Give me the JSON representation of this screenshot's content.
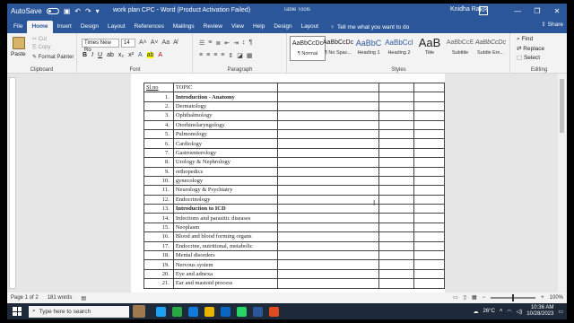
{
  "window": {
    "doc_title": "work plan CPC - Word (Product Activation Failed)",
    "context_title": "Table Tools",
    "user": "Knidha Raj",
    "user_badge": "KR",
    "autosave": "AutoSave",
    "controls": [
      "—",
      "❐",
      "✕"
    ]
  },
  "tabs": [
    "File",
    "Home",
    "Insert",
    "Design",
    "Layout",
    "References",
    "Mailings",
    "Review",
    "View",
    "Help",
    "Design",
    "Layout"
  ],
  "tell_me": "Tell me what you want to do",
  "share": "Share",
  "ribbon": {
    "clipboard": {
      "label": "Clipboard",
      "paste": "Paste",
      "cut": "Cut",
      "copy": "Copy",
      "format_painter": "Format Painter"
    },
    "font": {
      "label": "Font",
      "family": "Times New Ro",
      "size": "14"
    },
    "paragraph": {
      "label": "Paragraph"
    },
    "styles": {
      "label": "Styles",
      "items": [
        {
          "preview": "AaBbCcDc",
          "name": "¶ Normal"
        },
        {
          "preview": "AaBbCcDc",
          "name": "¶ No Spac..."
        },
        {
          "preview": "AaBbC",
          "name": "Heading 1"
        },
        {
          "preview": "AaBbCcI",
          "name": "Heading 2"
        },
        {
          "preview": "AaB",
          "name": "Title"
        },
        {
          "preview": "AaBbCcE",
          "name": "Subtitle"
        },
        {
          "preview": "AaBbCcDc",
          "name": "Subtle Em..."
        }
      ]
    },
    "editing": {
      "label": "Editing",
      "find": "Find",
      "replace": "Replace",
      "select": "Select"
    }
  },
  "table": {
    "header": {
      "sl": "Sl no",
      "topic": "TOPIC"
    },
    "rows": [
      {
        "n": "1.",
        "topic": "Introduction - Anatomy",
        "bold": true
      },
      {
        "n": "2.",
        "topic": "Dermatology"
      },
      {
        "n": "3.",
        "topic": "Ophthalmology"
      },
      {
        "n": "4.",
        "topic": "Otorhinolaryngology"
      },
      {
        "n": "5.",
        "topic": "Pulmonology"
      },
      {
        "n": "6.",
        "topic": "Cardiology"
      },
      {
        "n": "7.",
        "topic": "Gastroenterology"
      },
      {
        "n": "8.",
        "topic": "Urology & Nephrology"
      },
      {
        "n": "9.",
        "topic": "orthopedics"
      },
      {
        "n": "10.",
        "topic": "gynecology"
      },
      {
        "n": "11.",
        "topic": "Neurology & Psychiatry"
      },
      {
        "n": "12.",
        "topic": "Endocrinology"
      },
      {
        "n": "13.",
        "topic": "Introduction to ICD",
        "bold": true
      },
      {
        "n": "14.",
        "topic": "Infections and parasitic diseases"
      },
      {
        "n": "15.",
        "topic": "Neoplasm"
      },
      {
        "n": "16.",
        "topic": "Blood and blood forming organs"
      },
      {
        "n": "17.",
        "topic": "Endocrine, nutritional, metabolic"
      },
      {
        "n": "18.",
        "topic": "Mental disorders"
      },
      {
        "n": "19.",
        "topic": "Nervous system"
      },
      {
        "n": "20.",
        "topic": "Eye and adnexa"
      },
      {
        "n": "21.",
        "topic": "Ear and mastoid process"
      }
    ]
  },
  "status": {
    "page": "Page 1 of 2",
    "words": "181 words",
    "zoom": "100%"
  },
  "taskbar": {
    "search_placeholder": "Type here to search",
    "weather": "26°C",
    "time": "10:36 AM",
    "date": "10/28/2023",
    "app_colors": [
      "#1da1f2",
      "#2aa843",
      "#0f7ad8",
      "#e8b400",
      "#0a66c2",
      "#25d366",
      "#2b579a",
      "#e04a1f"
    ]
  },
  "colors": {
    "brand": "#2b579a"
  }
}
